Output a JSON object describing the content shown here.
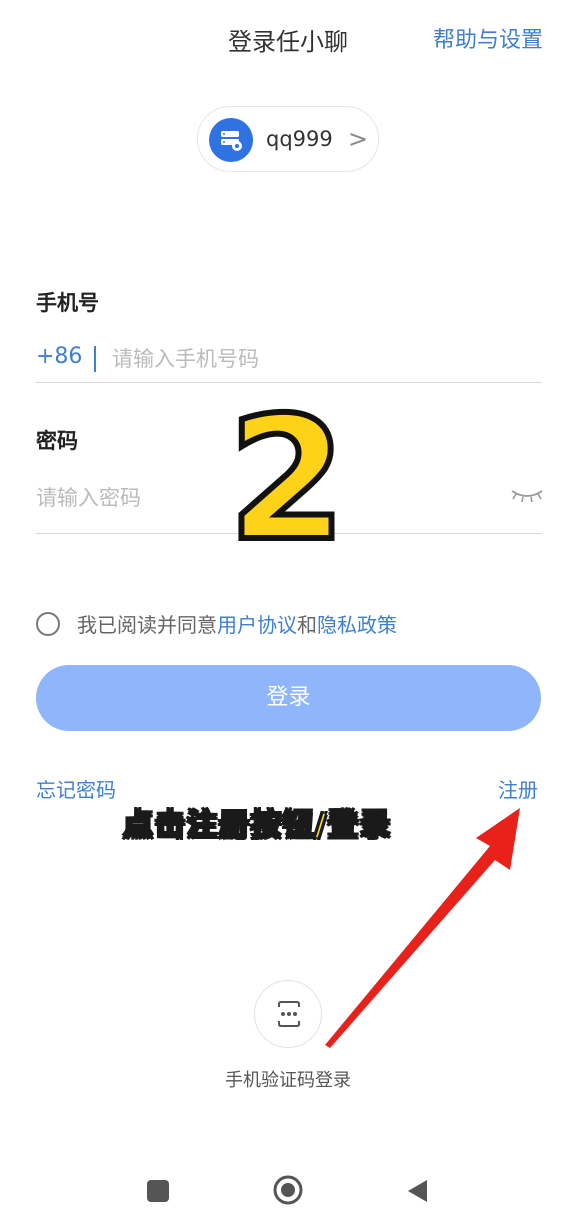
{
  "header": {
    "title": "登录任小聊",
    "help_settings": "帮助与设置"
  },
  "server": {
    "name": "qq999",
    "icon": "server-icon",
    "chevron": ">"
  },
  "phone": {
    "label": "手机号",
    "country_code": "+86",
    "placeholder": "请输入手机号码",
    "value": ""
  },
  "password": {
    "label": "密码",
    "placeholder": "请输入密码",
    "value": "",
    "toggle_icon": "eye-closed-icon"
  },
  "agreement": {
    "prefix": "我已阅读并同意",
    "user_agreement": "用户协议",
    "and": "和",
    "privacy_policy": "隐私政策",
    "checked": false
  },
  "login_button": "登录",
  "links": {
    "forgot_password": "忘记密码",
    "register": "注册"
  },
  "alt_login": {
    "label": "手机验证码登录",
    "icon": "sms-code-icon"
  },
  "overlay": {
    "step_number": "2",
    "caption": "点击注册按钮/登录"
  },
  "colors": {
    "accent": "#3f7fcf",
    "button_disabled": "#8fb6fa",
    "server_icon_bg": "#2f73e3",
    "overlay_yellow": "#ffd21a",
    "arrow_red": "#e8211b"
  }
}
